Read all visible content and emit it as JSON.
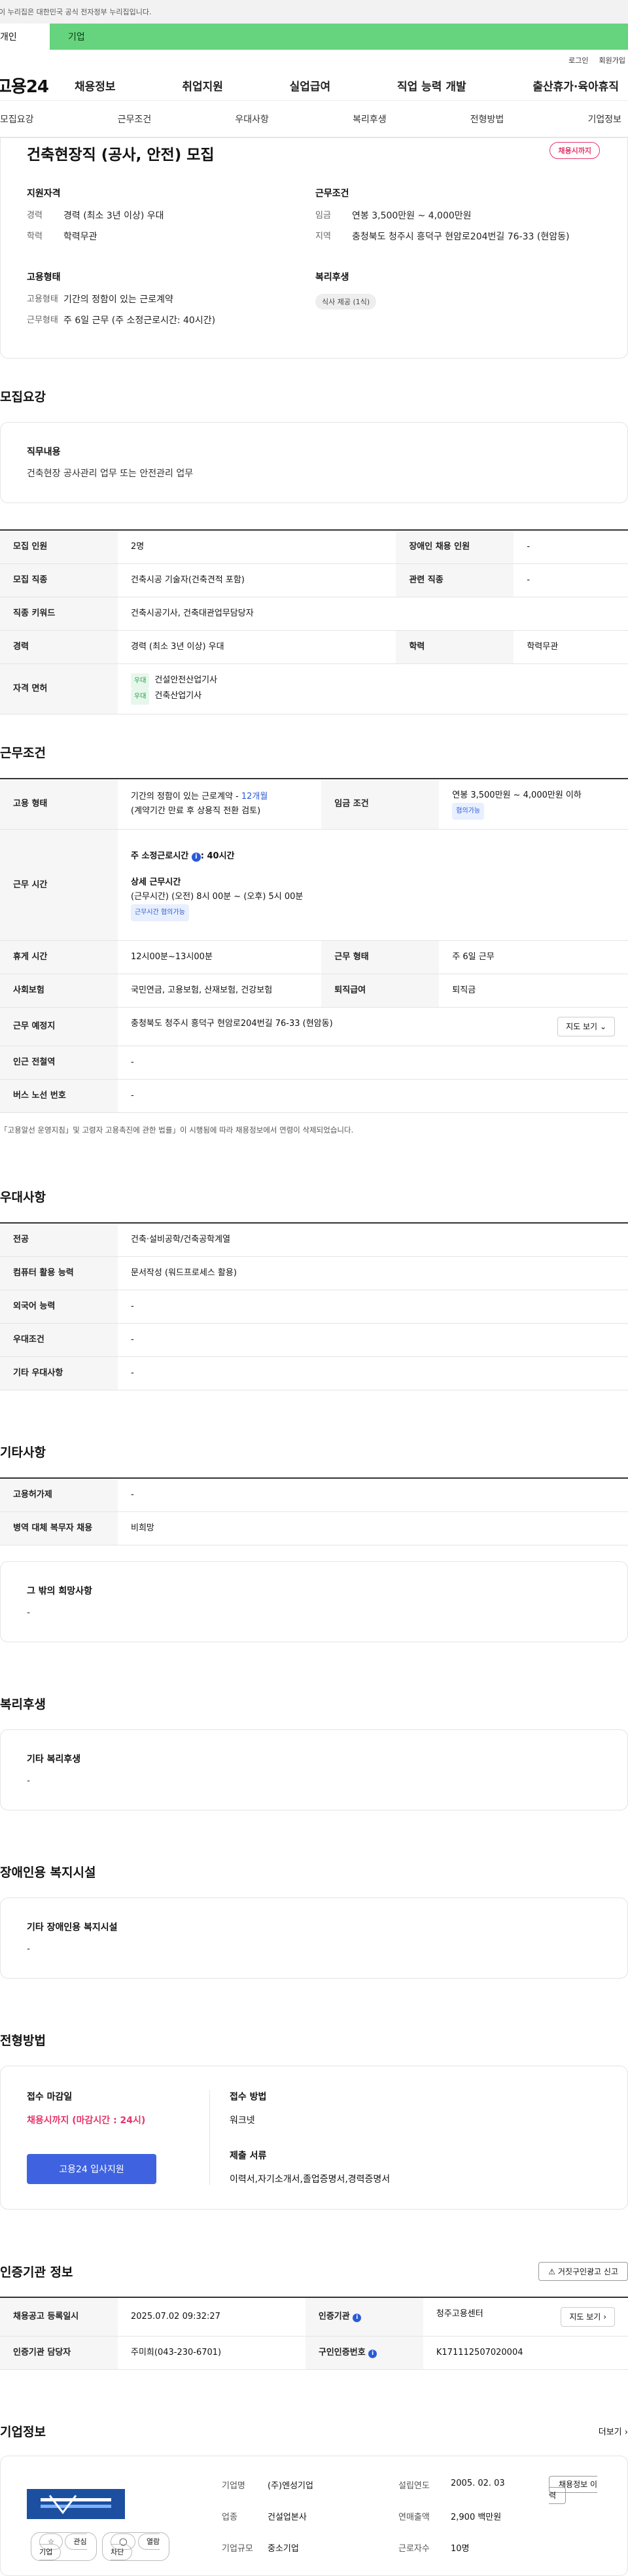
{
  "gov_notice": "이 누리집은 대한민국 공식 전자정부 누리집입니다.",
  "user_tabs": {
    "person": "개인",
    "corp": "기업"
  },
  "utility": {
    "login": "로그인",
    "join": "회원가입"
  },
  "logo": "고용24",
  "gnb": [
    "채용정보",
    "취업지원",
    "실업급여",
    "직업 능력 개발",
    "출산휴가·육아휴직"
  ],
  "subnav": [
    "모집요강",
    "근무조건",
    "우대사항",
    "복리후생",
    "전형방법",
    "기업정보"
  ],
  "header": {
    "title": "건축현장직 (공사, 안전) 모집",
    "status_badge": "채용시까지",
    "qual_title": "지원자격",
    "qual": [
      {
        "k": "경력",
        "v": "경력 (최소 3년 이상) 우대"
      },
      {
        "k": "학력",
        "v": "학력무관"
      }
    ],
    "cond_title": "근무조건",
    "cond": [
      {
        "k": "임금",
        "v": "연봉 3,500만원 ~ 4,000만원"
      },
      {
        "k": "지역",
        "v": "충청북도 청주시 흥덕구 현암로204번길 76-33 (현암동)"
      }
    ],
    "emp_title": "고용형태",
    "emp": [
      {
        "k": "고용형태",
        "v": "기간의 정함이 있는 근로계약"
      },
      {
        "k": "근무형태",
        "v": "주 6일 근무 (주 소정근로시간: 40시간)"
      }
    ],
    "welfare_title": "복리후생",
    "welfare_pill": "식사 제공 (1식)"
  },
  "recruit": {
    "section": "모집요강",
    "duty_title": "직무내용",
    "duty": "건축현장 공사관리 업무 또는 안전관리 업무",
    "rows": {
      "count_k": "모집 인원",
      "count_v": "2명",
      "disabled_k": "장애인 채용 인원",
      "disabled_v": "-",
      "job_k": "모집 직종",
      "job_v": "건축시공 기술자(건축견적 포함)",
      "related_k": "관련 직종",
      "related_v": "-",
      "keyword_k": "직종 키워드",
      "keyword_v": "건축시공기사, 건축대관업무담당자",
      "career_k": "경력",
      "career_v": "경력 (최소 3년 이상) 우대",
      "edu_k": "학력",
      "edu_v": "학력무관",
      "license_k": "자격 면허",
      "license_tag": "우대",
      "license1": "건설안전산업기사",
      "license2": "건축산업기사"
    }
  },
  "work": {
    "section": "근무조건",
    "emp_k": "고용 형태",
    "emp_v1": "기간의 정함이 있는 근로계약 - ",
    "emp_months": "12개월",
    "emp_v2": "(계약기간 만료 후 상용직 전환 검토)",
    "wage_k": "임금 조건",
    "wage_v": "연봉 3,500만원 ~ 4,000만원 이하",
    "wage_tag": "협의가능",
    "hours_k": "근무 시간",
    "hours_main": "주 소정근로시간",
    "hours_main_v": ": 40시간",
    "hours_detail_title": "상세 근무시간",
    "hours_detail": "(근무시간) (오전) 8시 00분 ~ (오후) 5시 00분",
    "hours_tag": "근무시간 협의가능",
    "break_k": "휴게 시간",
    "break_v": "12시00분~13시00분",
    "form_k": "근무 형태",
    "form_v": "주 6일 근무",
    "ins_k": "사회보험",
    "ins_v": "국민연금, 고용보험, 산재보험, 건강보험",
    "retire_k": "퇴직급여",
    "retire_v": "퇴직금",
    "place_k": "근무 예정지",
    "place_v": "충청북도 청주시 흥덕구 현암로204번길 76-33 (현암동)",
    "map_btn": "지도 보기",
    "station_k": "인근 전철역",
    "station_v": "-",
    "bus_k": "버스 노선 번호",
    "bus_v": "-",
    "note": "「고용알선 운영지침」및 고령자 고용촉진에 관한 법률」이 시행됨에 따라 채용정보에서 연령이 삭제되었습니다."
  },
  "pref": {
    "section": "우대사항",
    "major_k": "전공",
    "major_v": "건축·설비공학/건축공학계열",
    "pc_k": "컴퓨터 활용 능력",
    "pc_v": "문서작성 (워드프로세스 활용)",
    "lang_k": "외국어 능력",
    "lang_v": "-",
    "cond_k": "우대조건",
    "cond_v": "-",
    "etc_k": "기타 우대사항",
    "etc_v": "-"
  },
  "etc": {
    "section": "기타사항",
    "subsidy_k": "고용허가제",
    "subsidy_v": "-",
    "military_k": "병역 대체 복무자 채용",
    "military_v": "비희망",
    "wish_title": "그 밖의 희망사항",
    "wish_v": "-"
  },
  "welfare": {
    "section": "복리후생",
    "title": "기타 복리후생",
    "v": "-"
  },
  "facility": {
    "section": "장애인용 복지시설",
    "title": "기타 장애인용 복지시설",
    "v": "-"
  },
  "apply": {
    "section": "전형방법",
    "deadline_title": "접수 마감일",
    "deadline": "채용시까지 (마감시간 : 24시)",
    "btn": "고용24 입사지원",
    "method_title": "접수 방법",
    "method": "워크넷",
    "docs_title": "제출 서류",
    "docs": "이력서,자기소개서,졸업증명서,경력증명서"
  },
  "agency": {
    "section": "인증기관 정보",
    "report_btn": "거짓구인광고 신고",
    "reg_k": "채용공고 등록일시",
    "reg_v": "2025.07.02 09:32:27",
    "inst_k": "인증기관",
    "inst_v": "청주고용센터",
    "map_btn": "지도 보기",
    "staff_k": "인증기관 담당자",
    "staff_v": "주미희(043-230-6701)",
    "id_k": "구인인증번호",
    "id_v": "K171112507020004"
  },
  "company": {
    "section": "기업정보",
    "more": "더보기",
    "name_k": "기업명",
    "name_v": "(주)엔성기업",
    "founded_k": "설립연도",
    "founded_v": "2005. 02. 03",
    "history_btn": "채용정보 이력",
    "industry_k": "업종",
    "industry_v": "건설업본사",
    "revenue_k": "연매출액",
    "revenue_v": "2,900 백만원",
    "size_k": "기업규모",
    "size_v": "중소기업",
    "staff_k": "근로자수",
    "staff_v": "10명",
    "fav_btn": "관심기업",
    "block_btn": "열람차단"
  }
}
